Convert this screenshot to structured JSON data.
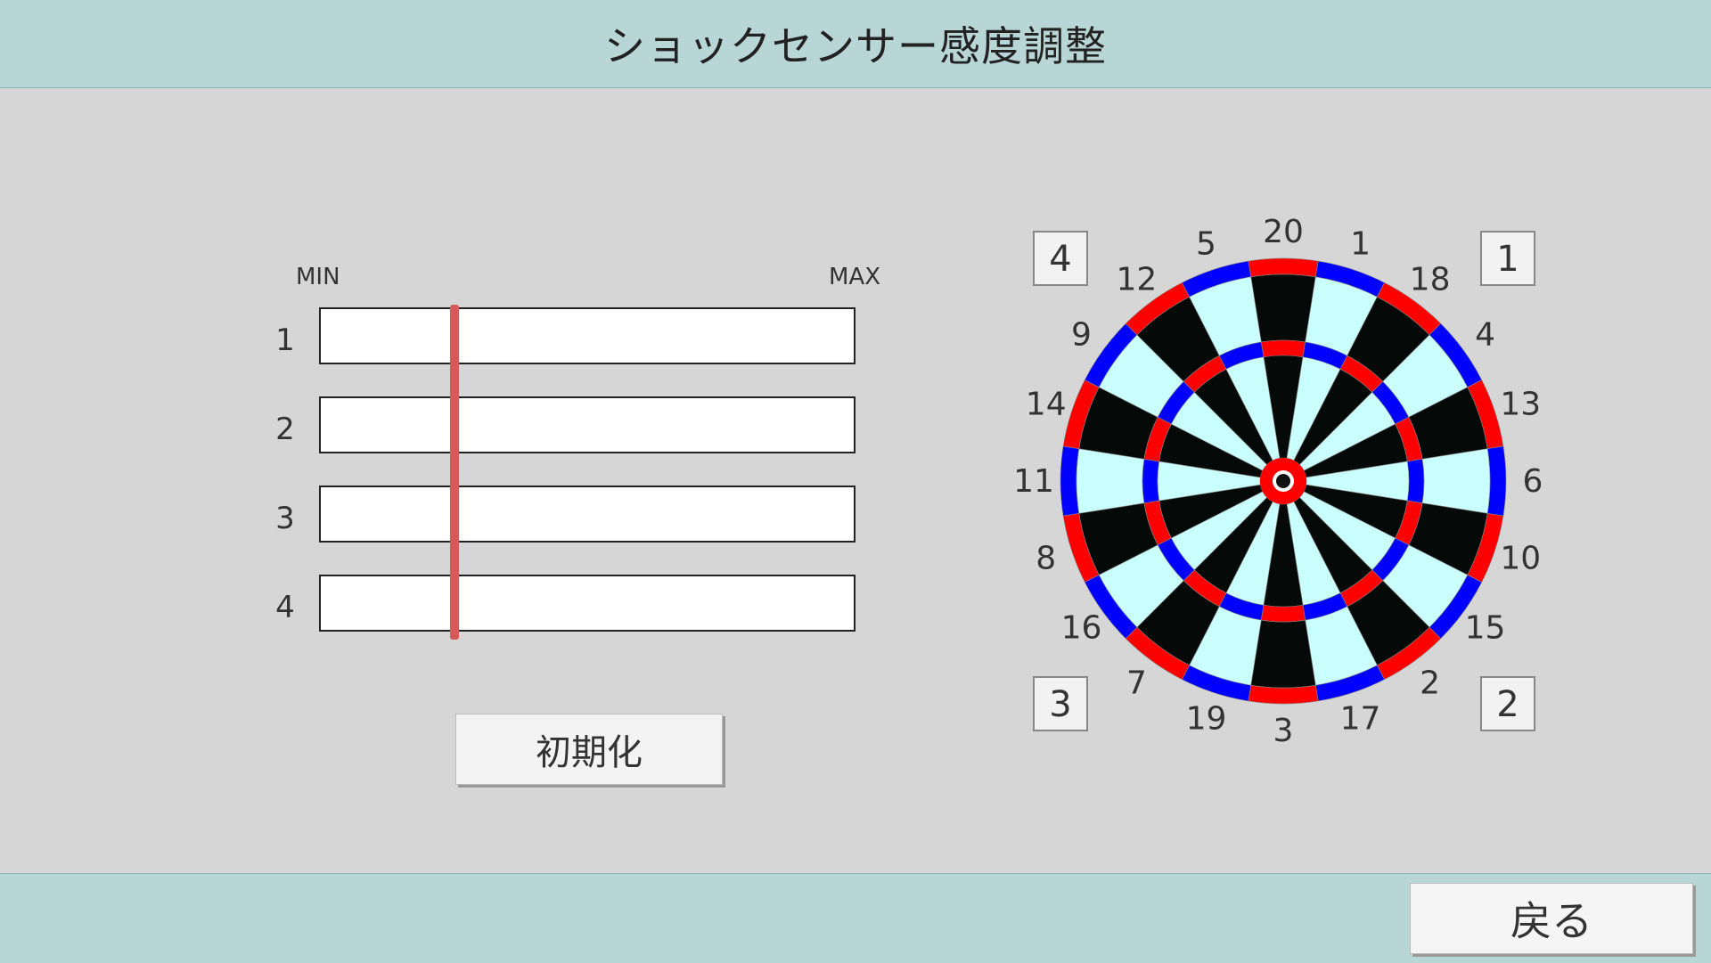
{
  "header": {
    "title": "ショックセンサー感度調整"
  },
  "sensitivity": {
    "min_label": "MIN",
    "max_label": "MAX",
    "rows": [
      {
        "label": "1",
        "level": 0.25
      },
      {
        "label": "2",
        "level": 0.25
      },
      {
        "label": "3",
        "level": 0.25
      },
      {
        "label": "4",
        "level": 0.25
      }
    ]
  },
  "init_button": {
    "label": "初期化"
  },
  "dartboard": {
    "numbers": [
      "20",
      "1",
      "18",
      "4",
      "13",
      "6",
      "10",
      "15",
      "2",
      "17",
      "3",
      "19",
      "7",
      "16",
      "8",
      "11",
      "14",
      "9",
      "12",
      "5"
    ],
    "sensors": [
      "1",
      "2",
      "3",
      "4"
    ],
    "colors": {
      "black": "#050a08",
      "light": "#c9fffd",
      "red": "#ff0000",
      "blue": "#0000ff"
    }
  },
  "footer": {
    "back_label": "戻る"
  }
}
